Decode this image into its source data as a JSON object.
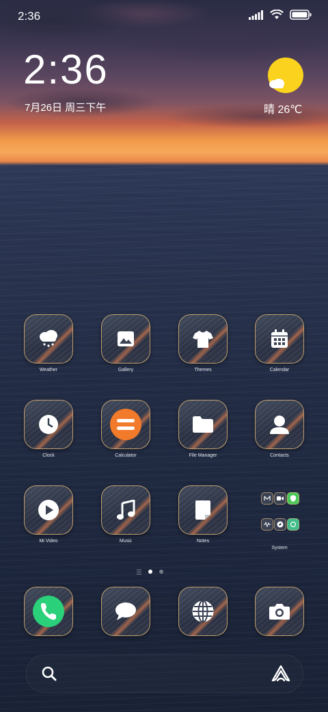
{
  "status_bar": {
    "time": "2:36"
  },
  "clock_widget": {
    "time": "2:36",
    "date": "7月26日 周三下午"
  },
  "weather_widget": {
    "condition_temp": "晴 26℃"
  },
  "apps": [
    {
      "label": "Weather"
    },
    {
      "label": "Gallery"
    },
    {
      "label": "Themes"
    },
    {
      "label": "Calendar"
    },
    {
      "label": "Clock"
    },
    {
      "label": "Calculator"
    },
    {
      "label": "File Manager"
    },
    {
      "label": "Contacts"
    },
    {
      "label": "Mi Video"
    },
    {
      "label": "Music"
    },
    {
      "label": "Notes"
    },
    {
      "label": "System"
    }
  ],
  "colors": {
    "accent_orange": "#f27a2b",
    "phone_green": "#2bd07a",
    "sun_yellow": "#fbd21e"
  }
}
